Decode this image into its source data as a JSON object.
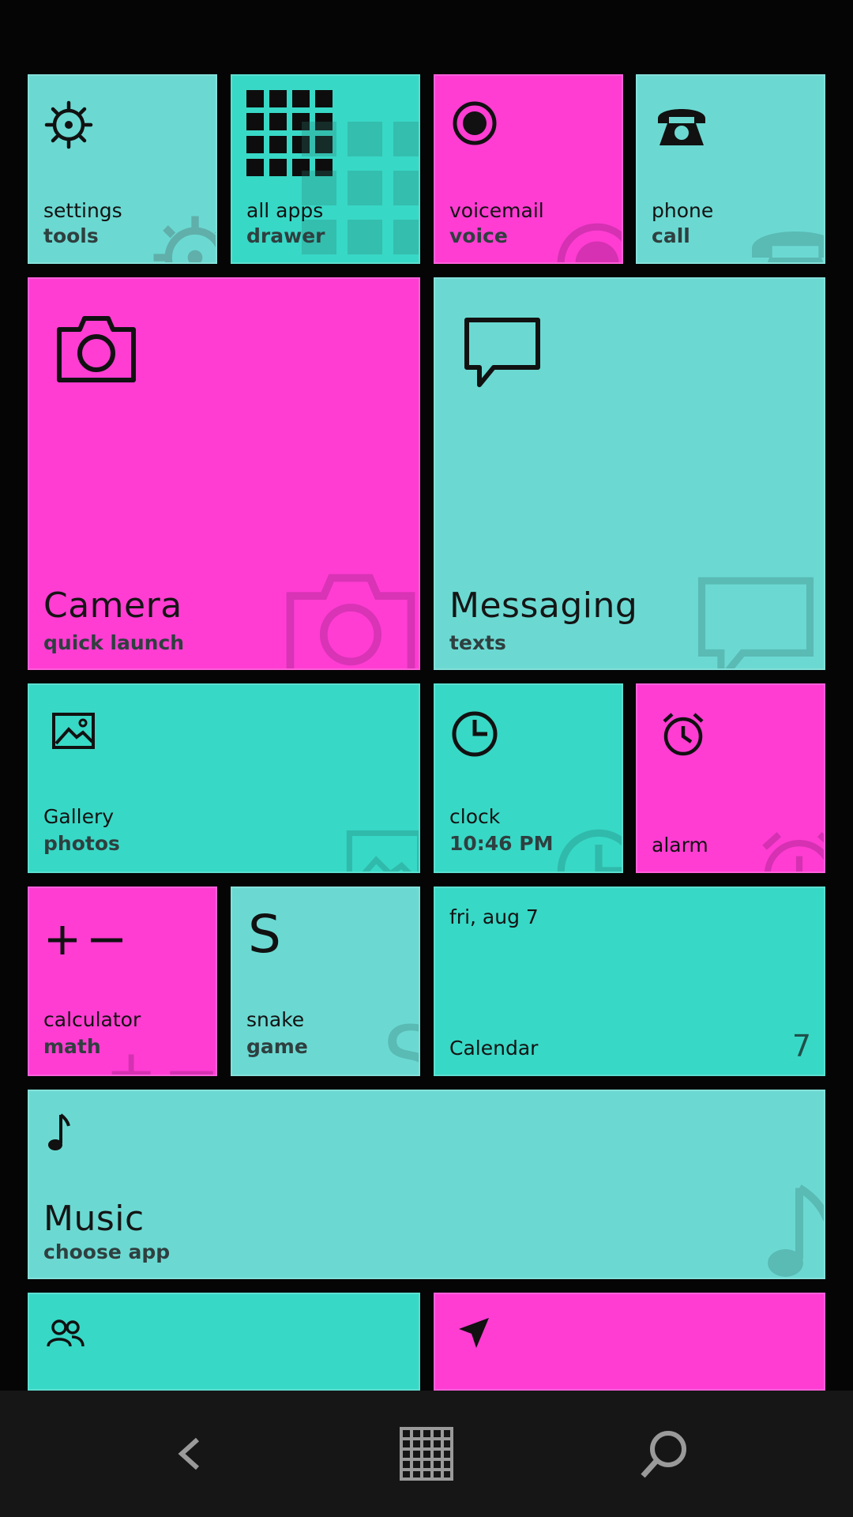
{
  "colors": {
    "cyan": "#6bd9d2",
    "teal": "#38d8c6",
    "pink": "#ff3dd3",
    "background": "#050505",
    "navbar": "#161616"
  },
  "tiles": {
    "settings": {
      "title": "settings",
      "subtitle": "tools",
      "icon": "gear-icon"
    },
    "all_apps": {
      "title": "all apps",
      "subtitle": "drawer",
      "icon": "grid-icon"
    },
    "voicemail": {
      "title": "voicemail",
      "subtitle": "voice",
      "icon": "record-icon"
    },
    "phone": {
      "title": "phone",
      "subtitle": "call",
      "icon": "phone-icon"
    },
    "camera": {
      "title": "Camera",
      "subtitle": "quick launch",
      "icon": "camera-icon"
    },
    "messaging": {
      "title": "Messaging",
      "subtitle": "texts",
      "icon": "message-icon"
    },
    "gallery": {
      "title": "Gallery",
      "subtitle": "photos",
      "icon": "image-icon"
    },
    "clock": {
      "title": "clock",
      "subtitle": "10:46 PM",
      "icon": "clock-icon"
    },
    "alarm": {
      "title": "alarm",
      "icon": "alarm-clock-icon"
    },
    "calculator": {
      "title": "calculator",
      "subtitle": "math",
      "icon": "plus-minus-icon"
    },
    "snake": {
      "title": "snake",
      "subtitle": "game",
      "icon_letter": "S"
    },
    "calendar": {
      "date": "fri, aug 7",
      "title": "Calendar",
      "day_number": "7"
    },
    "music": {
      "title": "Music",
      "subtitle": "choose app",
      "icon": "music-note-icon"
    },
    "people": {
      "icon": "people-icon"
    },
    "maps": {
      "icon": "navigation-arrow-icon"
    }
  },
  "navbar": {
    "back": "back-icon",
    "home": "grid-icon",
    "search": "search-icon"
  }
}
